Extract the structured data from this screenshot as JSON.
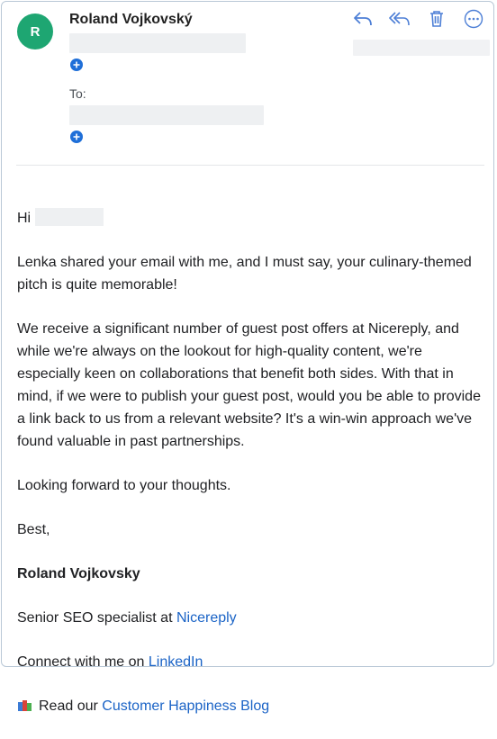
{
  "sender": {
    "avatar_letter": "R",
    "name": "Roland Vojkovský"
  },
  "recipients": {
    "to_label": "To:"
  },
  "actions": [
    "reply-icon",
    "reply-all-icon",
    "trash-icon",
    "more-icon"
  ],
  "colors": {
    "avatar": "#1ea672",
    "link": "#1a63c6",
    "plus": "#1f6fd8",
    "icon": "#4d7fd6"
  },
  "message": {
    "greeting": "Hi",
    "p1": "Lenka shared your email with me, and I must say, your culinary-themed pitch is quite memorable!",
    "p2": "We receive a significant number of guest post offers at Nicereply, and while we're always on the lookout for high-quality content, we're especially keen on collaborations that benefit both sides. With that in mind, if we were to publish your guest post, would you be able to provide a link back to us from a relevant website? It's a win-win approach we've found valuable in past partnerships.",
    "closing": "Looking forward to your thoughts.",
    "signoff": "Best,"
  },
  "signature": {
    "name": "Roland Vojkovsky",
    "role_prefix": "Senior SEO specialist at",
    "company_link": "Nicereply",
    "connect_prefix": "Connect with me on",
    "linkedin_link": "LinkedIn",
    "blog_prefix": "Read our",
    "blog_link": "Customer Happiness Blog"
  }
}
